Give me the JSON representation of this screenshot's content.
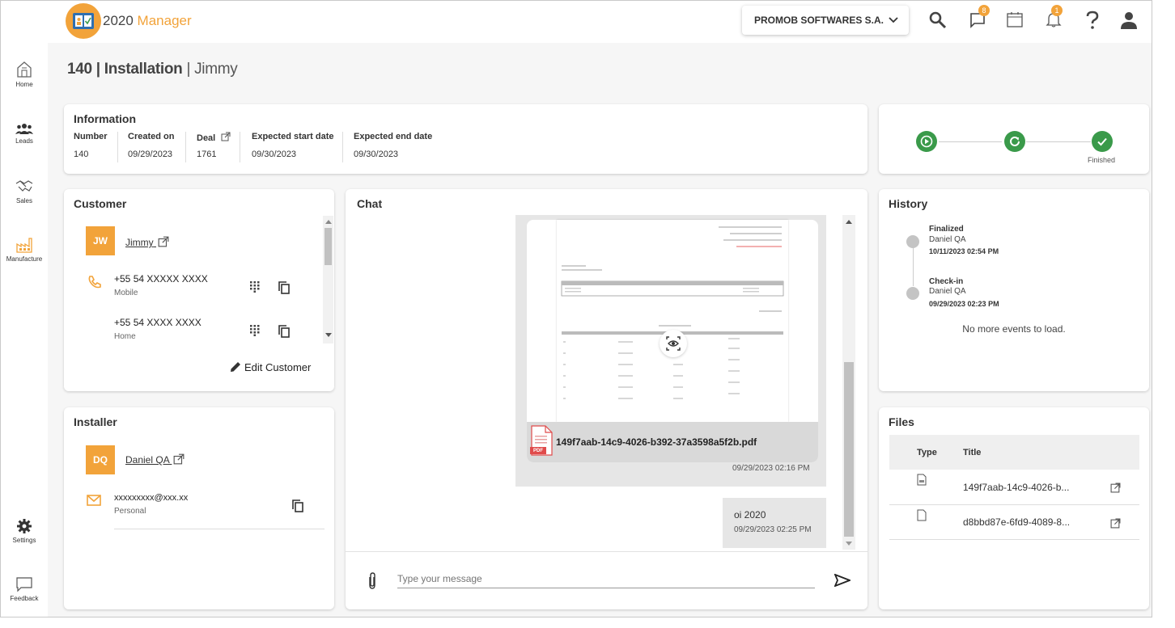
{
  "app": {
    "logo_text_a": "2020",
    "logo_text_b": " Manager"
  },
  "sidebar": {
    "items": [
      {
        "label": "Home",
        "icon": "home-icon"
      },
      {
        "label": "Leads",
        "icon": "people-icon"
      },
      {
        "label": "Sales",
        "icon": "handshake-icon"
      },
      {
        "label": "Manufacture",
        "icon": "factory-icon"
      }
    ],
    "bottom": [
      {
        "label": "Settings",
        "icon": "gear-icon"
      },
      {
        "label": "Feedback",
        "icon": "feedback-icon"
      }
    ]
  },
  "header": {
    "company": "PROMOB SOFTWARES S.A.",
    "messages_count": "8",
    "notifications_count": "1"
  },
  "page": {
    "number": "140",
    "type": "Installation",
    "person": "Jimmy"
  },
  "information": {
    "title": "Information",
    "fields": [
      {
        "label": "Number",
        "value": "140"
      },
      {
        "label": "Created on",
        "value": "09/29/2023"
      },
      {
        "label": "Deal",
        "value": "1761"
      },
      {
        "label": "Expected start date",
        "value": "09/30/2023"
      },
      {
        "label": "Expected end date",
        "value": "09/30/2023"
      }
    ]
  },
  "status": {
    "finished_label": "Finished"
  },
  "customer": {
    "title": "Customer",
    "initials": "JW",
    "name": "Jimmy",
    "phones": [
      {
        "number": "+55 54 XXXXX XXXX",
        "type": "Mobile"
      },
      {
        "number": "+55 54 XXXX XXXX",
        "type": "Home"
      }
    ],
    "edit_label": "Edit Customer"
  },
  "installer": {
    "title": "Installer",
    "initials": "DQ",
    "name": "Daniel QA",
    "email": "xxxxxxxxx@xxx.xx",
    "email_type": "Personal"
  },
  "chat": {
    "title": "Chat",
    "file_name": "149f7aab-14c9-4026-b392-37a3598a5f2b.pdf",
    "file_badge": "PDF",
    "file_time": "09/29/2023 02:16 PM",
    "message_text": "oi 2020",
    "message_time": "09/29/2023 02:25 PM",
    "input_placeholder": "Type your message"
  },
  "history": {
    "title": "History",
    "events": [
      {
        "title": "Finalized",
        "user": "Daniel QA",
        "time": "10/11/2023 02:54 PM"
      },
      {
        "title": "Check-in",
        "user": "Daniel QA",
        "time": "09/29/2023 02:23 PM"
      }
    ],
    "empty_text": "No more events to load."
  },
  "files": {
    "title": "Files",
    "columns": [
      "Type",
      "Title"
    ],
    "rows": [
      {
        "type_icon": "pdf-file-icon",
        "title": "149f7aab-14c9-4026-b..."
      },
      {
        "type_icon": "file-icon",
        "title": "d8bbd87e-6fd9-4089-8..."
      }
    ]
  },
  "colors": {
    "accent": "#f2a33a",
    "success": "#3a9a4a"
  }
}
